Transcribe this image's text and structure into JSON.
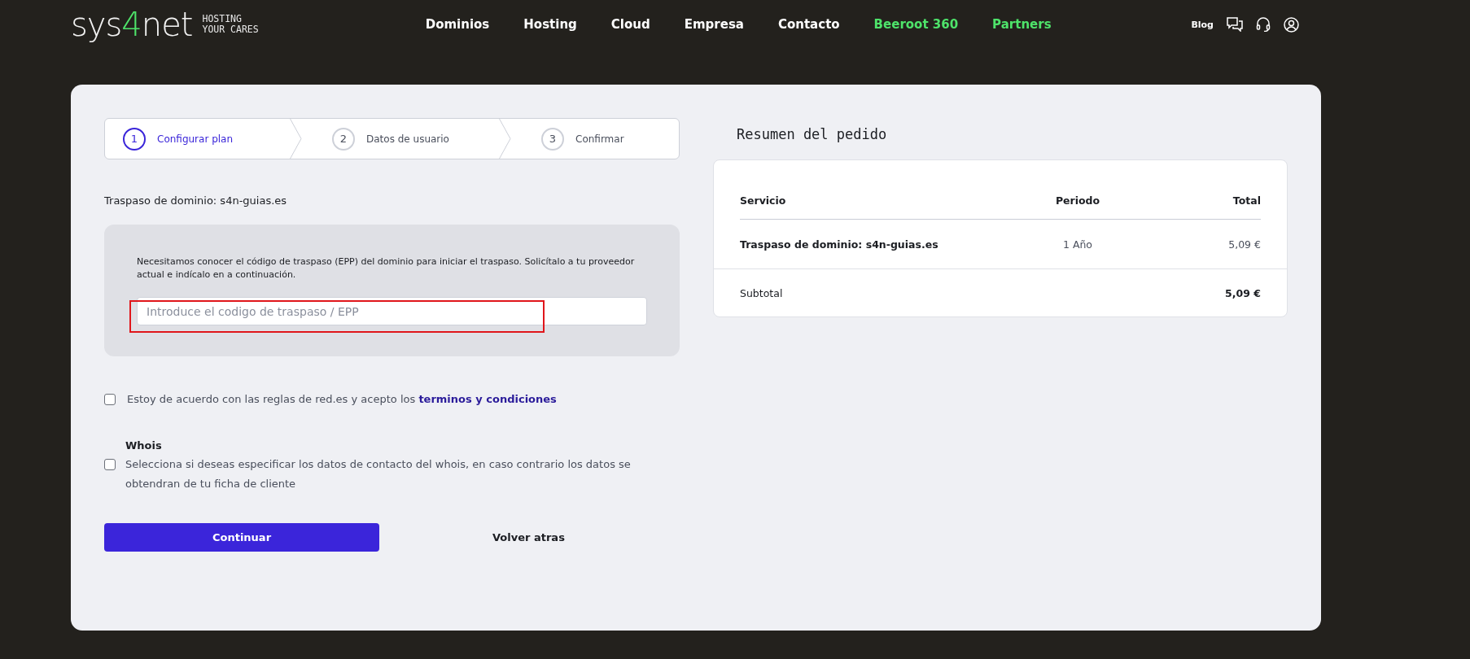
{
  "header": {
    "logo": {
      "parts": [
        {
          "text": "sys",
          "accent": false
        },
        {
          "text": "4",
          "accent": true
        },
        {
          "text": "net",
          "accent": false
        }
      ],
      "tagline": [
        "HOSTING",
        "YOUR CARES"
      ]
    },
    "nav": [
      {
        "label": "Dominios",
        "color": "#ffffff"
      },
      {
        "label": "Hosting",
        "color": "#ffffff"
      },
      {
        "label": "Cloud",
        "color": "#ffffff"
      },
      {
        "label": "Empresa",
        "color": "#ffffff"
      },
      {
        "label": "Contacto",
        "color": "#ffffff"
      },
      {
        "label": "Beeroot 360",
        "color": "#4ee36a"
      },
      {
        "label": "Partners",
        "color": "#4ee36a"
      }
    ],
    "blog": "Blog"
  },
  "steps": [
    {
      "number": "1",
      "label": "Configurar plan",
      "selected": true
    },
    {
      "number": "2",
      "label": "Datos de usuario",
      "selected": false
    },
    {
      "number": "3",
      "label": "Confirmar",
      "selected": false
    }
  ],
  "domain_title": "Traspaso de dominio: s4n-guias.es",
  "epp": {
    "description": "Necesitamos conocer el código de traspaso (EPP) del dominio para iniciar el traspaso. Solicítalo a tu proveedor actual e indícalo en a continuación.",
    "placeholder": "Introduce el codigo de traspaso / EPP",
    "highlighted": true
  },
  "terms": {
    "checked": false,
    "text": "Estoy de acuerdo con las reglas de red.es y acepto los",
    "link": "terminos y condiciones"
  },
  "whois": {
    "checked": false,
    "title": "Whois",
    "description": "Selecciona si deseas especificar los datos de contacto del whois, en caso contrario los datos se obtendran de tu ficha de cliente"
  },
  "buttons": {
    "primary": "Continuar",
    "secondary": "Volver atras"
  },
  "summary": {
    "title": "Resumen del pedido",
    "columns": [
      "Servicio",
      "Periodo",
      "Total"
    ],
    "rows": [
      {
        "service": "Traspaso de dominio: s4n-guias.es",
        "period": "1 Año",
        "total": "5,09 €"
      }
    ],
    "subtotal": {
      "label": "Subtotal",
      "value": "5,09 €"
    }
  }
}
